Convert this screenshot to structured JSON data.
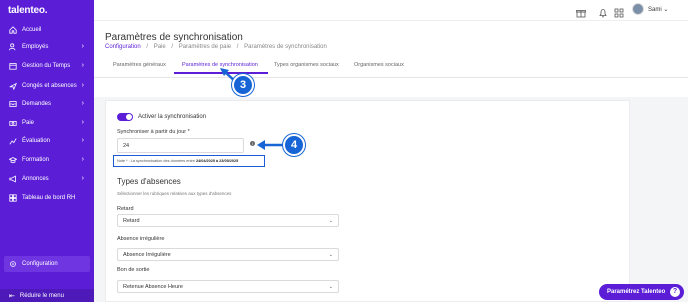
{
  "app": {
    "logo": "talenteo."
  },
  "sidebar": {
    "items": [
      {
        "label": "Accueil",
        "icon": "home-icon",
        "chevron": ""
      },
      {
        "label": "Employés",
        "icon": "users-icon",
        "chevron": "›"
      },
      {
        "label": "Gestion du Temps",
        "icon": "calendar-icon",
        "chevron": "›"
      },
      {
        "label": "Congés et absences",
        "icon": "plane-icon",
        "chevron": "›"
      },
      {
        "label": "Demandes",
        "icon": "inbox-icon",
        "chevron": "›"
      },
      {
        "label": "Paie",
        "icon": "money-icon",
        "chevron": "›"
      },
      {
        "label": "Évaluation",
        "icon": "chart-icon",
        "chevron": "›"
      },
      {
        "label": "Formation",
        "icon": "graduation-icon",
        "chevron": "›"
      },
      {
        "label": "Annonces",
        "icon": "megaphone-icon",
        "chevron": "›"
      },
      {
        "label": "Tableau de bord RH",
        "icon": "dashboard-icon",
        "chevron": ""
      }
    ],
    "config": {
      "label": "Configuration",
      "icon": "gear-icon"
    },
    "reduce": {
      "label": "Réduire le menu",
      "icon": "collapse-icon"
    }
  },
  "topbar": {
    "user_name": "Sami ⌄"
  },
  "header": {
    "title": "Paramètres de synchronisation",
    "breadcrumb": [
      "Configuration",
      "/",
      "Paie",
      "/",
      "Paramètres de paie",
      "/",
      "Paramètres de synchronisation"
    ],
    "tabs": [
      {
        "label": "Paramètres généraux"
      },
      {
        "label": "Paramètres de synchronisation"
      },
      {
        "label": "Types organismes sociaux"
      },
      {
        "label": "Organismes sociaux"
      }
    ]
  },
  "form": {
    "toggle_label": "Activer la synchronisation",
    "sync_from_label": "Synchroniser à partir du jour *",
    "sync_from_value": "24",
    "note_prefix": "Note * : La synchronisation des données entre ",
    "note_bold": "24/04/2025 à 23/05/2025",
    "section_title": "Types d'absences",
    "section_sub": "Sélectionner les rubriques relatives aux types d'absences",
    "selects": [
      {
        "label": "Retard",
        "value": "Retard"
      },
      {
        "label": "Absence irrégulière",
        "value": "Absence Irrégulière"
      },
      {
        "label": "Bon de sortie",
        "value": "Retenue Absence Heure"
      }
    ]
  },
  "callouts": {
    "step3": "3",
    "step4": "4"
  },
  "help_button": {
    "label": "Paramétrez Talenteo",
    "q": "?"
  },
  "colors": {
    "brand": "#5b1ed6",
    "callout": "#1764d6"
  }
}
